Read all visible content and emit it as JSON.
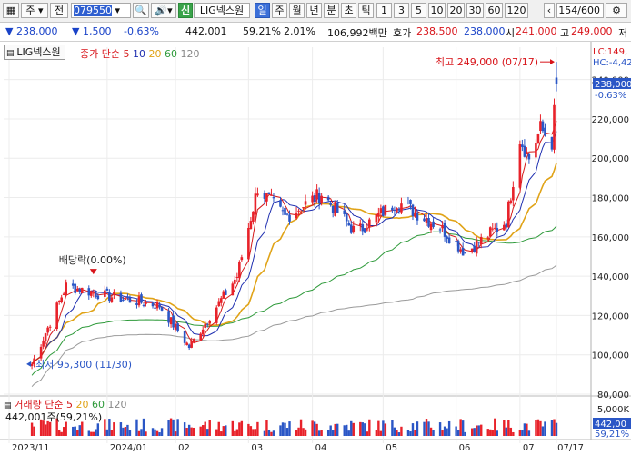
{
  "toolbar": {
    "market": "주",
    "prev_label": "전",
    "code": "079550",
    "shin_label": "신",
    "stock_name": "LIG넥스원",
    "periods": [
      "일",
      "주",
      "월",
      "년",
      "분",
      "초",
      "틱"
    ],
    "selected_period": "일",
    "intervals": [
      "1",
      "3",
      "5",
      "10",
      "20",
      "30",
      "60",
      "120"
    ],
    "count": "154/600"
  },
  "info": {
    "price": "238,000",
    "change": "1,500",
    "change_pct": "-0.63%",
    "volume": "442,001",
    "vol_ratio": "59.21%",
    "turnover": "2.01%",
    "amount": "106,992백만",
    "quote_label": "호가",
    "ask": "238,500",
    "bid": "238,000",
    "open_label": "시",
    "open": "241,000",
    "high_label": "고",
    "high": "249,000",
    "low_label": "저"
  },
  "chart": {
    "stock_box": "LIG넥스원",
    "ma_legend": {
      "label": "종가 단순",
      "periods": [
        "5",
        "10",
        "20",
        "60",
        "120"
      ]
    },
    "vol_legend": {
      "label": "거래량 단순",
      "periods": [
        "5",
        "20",
        "60",
        "120"
      ]
    },
    "high_annot": "최고 249,000 (07/17)",
    "low_annot": "최저 95,300 (11/30)",
    "div_annot": "배당락(0.00%)",
    "vol_annot": "442,001주(59,21%)",
    "right_lc": "LC:149,",
    "right_hc": "HC:-4,42",
    "price_tag": "238,000",
    "pct_tag": "-0.63%",
    "vol_tag": "442,00",
    "vol_pct_tag": "59,21%",
    "vol_axis_5000": "5,000K",
    "y_ticks": [
      "240,000",
      "220,000",
      "200,000",
      "180,000",
      "160,000",
      "140,000",
      "120,000",
      "100,000",
      "80,000"
    ],
    "x_ticks": [
      "2023/11",
      "2024/01",
      "02",
      "03",
      "04",
      "05",
      "06",
      "07",
      "07/17"
    ],
    "colors": {
      "up": "#e8222a",
      "down": "#2a56c6",
      "ma5": "#d41a1a",
      "ma10": "#1f2fb0",
      "ma20": "#e0a317",
      "ma60": "#2e9a3a",
      "ma120": "#9a9a9a"
    }
  },
  "chart_data": {
    "type": "candlestick",
    "title": "LIG넥스원",
    "ylim": [
      80000,
      250000
    ],
    "x": [
      "2023/11",
      "2024/01",
      "02",
      "03",
      "04",
      "05",
      "06",
      "07",
      "07/17"
    ],
    "anchors_close": [
      [
        "2023/11/30",
        95300
      ],
      [
        "2023/12/15",
        135000
      ],
      [
        "2024/01/02",
        130000
      ],
      [
        "2024/01/25",
        125000
      ],
      [
        "2024/02/07",
        104000
      ],
      [
        "2024/02/28",
        140000
      ],
      [
        "2024/03/08",
        185000
      ],
      [
        "2024/03/20",
        170000
      ],
      [
        "2024/04/05",
        182000
      ],
      [
        "2024/04/20",
        162000
      ],
      [
        "2024/05/08",
        178000
      ],
      [
        "2024/05/27",
        165000
      ],
      [
        "2024/06/07",
        152000
      ],
      [
        "2024/06/25",
        168000
      ],
      [
        "2024/07/01",
        210000
      ],
      [
        "2024/07/05",
        200000
      ],
      [
        "2024/07/10",
        215000
      ],
      [
        "2024/07/15",
        208000
      ],
      [
        "2024/07/17",
        238000
      ]
    ],
    "high": 249000,
    "high_date": "07/17",
    "low": 95300,
    "low_date": "11/30",
    "last_volume": 442001,
    "ma_periods": [
      5,
      10,
      20,
      60,
      120
    ]
  }
}
